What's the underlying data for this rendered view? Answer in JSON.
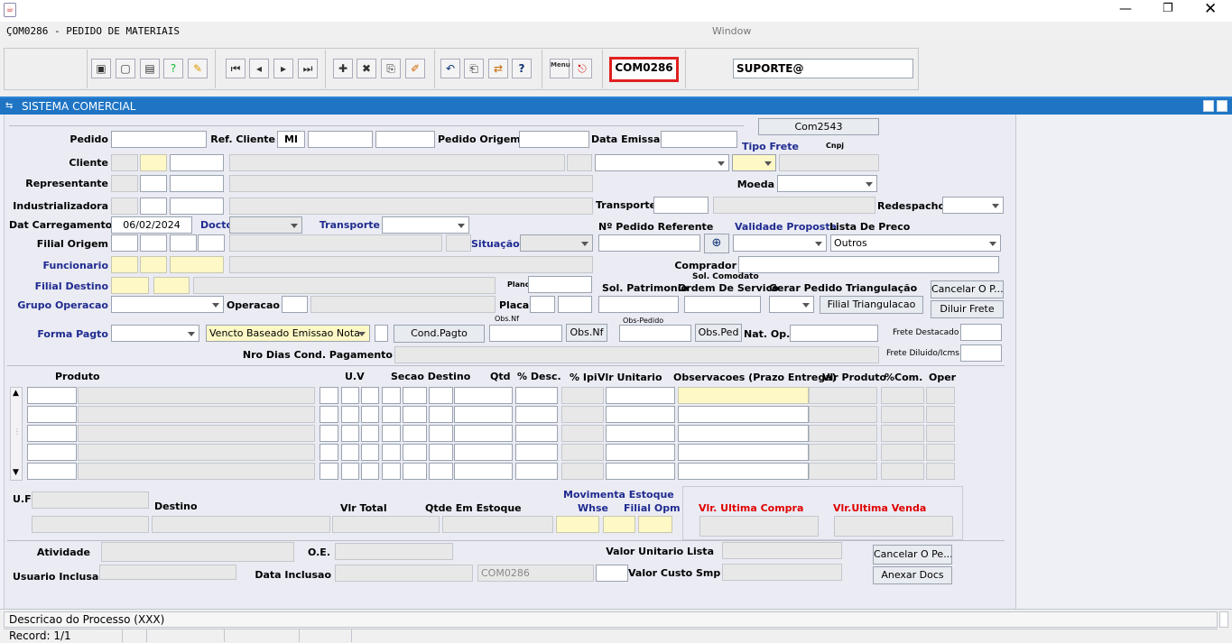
{
  "window": {
    "title": "ÇOM0286 - PEDIDO DE MATERIAIS",
    "menu": "Window"
  },
  "toolbar": {
    "form_code": "COM0286",
    "user": "SUPORTE@",
    "menu_icon_label": "Menu"
  },
  "panel": {
    "title": "SISTEMA COMERCIAL"
  },
  "header_form": {
    "labels": {
      "pedido": "Pedido",
      "ref_cliente": "Ref. Cliente",
      "pedido_origem": "Pedido Origem",
      "data_emissao": "Data Emissao",
      "tipo_frete": "Tipo Frete",
      "cnpj": "Cnpj",
      "cliente": "Cliente",
      "representante": "Representante",
      "moeda": "Moeda",
      "industrializadora": "Industrializadora",
      "transporte": "Transporte",
      "redespacho": "Redespacho",
      "dat_carregamento": "Dat Carregamento",
      "docto": "Docto",
      "transporte2": "Transporte",
      "num_pedido_ref": "Nº Pedido Referente",
      "validade_proposta": "Validade Proposta",
      "lista_preco": "Lista De Preco",
      "filial_origem": "Filial Origem",
      "situacao": "Situação",
      "funcionario": "Funcionario",
      "comprador": "Comprador",
      "filial_destino": "Filial Destino",
      "plano": "Plano",
      "sol_comodato": "Sol. Comodato",
      "sol_patrimonio": "Sol. Patrimonio",
      "ordem_servico": "Ordem De Servico",
      "gerar_triangulacao": "Gerar Pedido Triangulação",
      "grupo_operacao": "Grupo Operacao",
      "operacao": "Operacao",
      "placa": "Placa",
      "obs_nf_small": "Obs.Nf",
      "obs_pedido_small": "Obs-Pedido",
      "forma_pagto": "Forma Pagto",
      "nat_op": "Nat. Op.",
      "frete_destacado": "Frete Destacado",
      "nro_dias": "Nro Dias Cond. Pagamento",
      "frete_diluido": "Frete Diluido/Icms"
    },
    "values": {
      "ref_cliente_prefix": "MI",
      "dat_carregamento": "06/02/2024",
      "lista_preco": "Outros",
      "forma_pagto_tipo": "Vencto Baseado Emissao Nota"
    },
    "buttons": {
      "com2543": "Com2543",
      "cond_pagto": "Cond.Pagto",
      "obs_nf": "Obs.Nf",
      "obs_ped": "Obs.Ped",
      "filial_triangulacao": "Filial Triangulacao",
      "cancelar_op": "Cancelar O P...",
      "diluir_frete": "Diluir Frete"
    }
  },
  "items_table": {
    "columns": {
      "produto": "Produto",
      "uv": "U.V",
      "secao_destino": "Secao Destino",
      "qtd": "Qtd",
      "desc": "% Desc.",
      "ipi": "% Ipi",
      "vlr_unitario": "Vlr Unitario",
      "observacoes": "Observacoes (Prazo Entrega)",
      "vlr_produto": "Vlr Produto",
      "com": "%Com.",
      "oper": "Oper"
    }
  },
  "detail": {
    "labels": {
      "uf": "U.F",
      "destino": "Destino",
      "vlr_total": "Vlr Total",
      "qtde_estoque": "Qtde Em Estoque",
      "movimenta_estoque": "Movimenta Estoque",
      "whse": "Whse",
      "filial_opm": "Filial Opm",
      "vlr_ultima_compra": "Vlr. Ultima Compra",
      "vlr_ultima_venda": "Vlr.Ultima Venda"
    }
  },
  "footer_form": {
    "labels": {
      "atividade": "Atividade",
      "oe": "O.E.",
      "valor_unitario_lista": "Valor Unitario Lista",
      "usuario_inclusao": "Usuario Inclusao",
      "data_inclusao": "Data Inclusao",
      "valor_custo_smp": "Valor Custo Smp"
    },
    "values": {
      "form_code": "COM0286"
    },
    "buttons": {
      "cancelar_ope": "Cancelar O Pe...",
      "anexar_docs": "Anexar Docs"
    }
  },
  "status": {
    "process": "Descricao do Processo (XXX)",
    "record": "Record: 1/1"
  },
  "colors": {
    "accent": "#1f74c4",
    "highlight": "#e02020",
    "label_blue": "#1f2b8f",
    "field_yellow": "#fdf8c6"
  }
}
